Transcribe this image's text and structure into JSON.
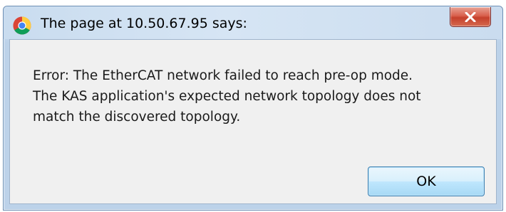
{
  "dialog": {
    "title": "The page at 10.50.67.95 says:",
    "app_icon": "chrome-icon",
    "close_icon": "close-icon",
    "message_lines": [
      "Error: The EtherCAT network failed to reach pre-op mode.",
      "The KAS application's expected network topology does not",
      "match the discovered topology."
    ],
    "ok_label": "OK"
  },
  "colors": {
    "titlebar": "#c9dcef",
    "close_button": "#c5402c",
    "client_background": "#f0f0f0",
    "ok_border": "#3c7fb1"
  }
}
